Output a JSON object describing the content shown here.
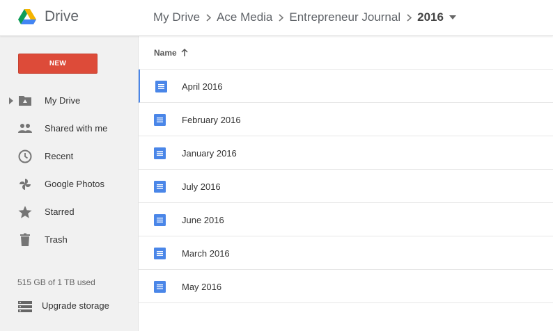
{
  "app": {
    "title": "Drive",
    "logo_icon": "google-drive-logo",
    "logo_colors": [
      "#0f9d58",
      "#f4b400",
      "#4285f4"
    ]
  },
  "breadcrumb": {
    "items": [
      "My Drive",
      "Ace Media",
      "Entrepreneur Journal"
    ],
    "current": "2016",
    "separator_icon": "chevron-right-icon",
    "dropdown_icon": "caret-down-icon"
  },
  "sidebar": {
    "new_button_label": "NEW",
    "new_button_color": "#dd4b39",
    "items": [
      {
        "label": "My Drive",
        "icon": "my-drive-folder-icon"
      },
      {
        "label": "Shared with me",
        "icon": "people-icon"
      },
      {
        "label": "Recent",
        "icon": "clock-icon"
      },
      {
        "label": "Google Photos",
        "icon": "pinwheel-icon"
      },
      {
        "label": "Starred",
        "icon": "star-icon"
      },
      {
        "label": "Trash",
        "icon": "trash-icon"
      }
    ],
    "storage_text": "515 GB of 1 TB used",
    "upgrade_label": "Upgrade storage",
    "upgrade_icon": "storage-icon"
  },
  "list": {
    "column_name": "Name",
    "sort_icon": "arrow-up-icon",
    "file_icon": "google-docs-icon",
    "file_icon_color": "#4a86e8",
    "files": [
      {
        "name": "April 2016"
      },
      {
        "name": "February 2016"
      },
      {
        "name": "January 2016"
      },
      {
        "name": "July 2016"
      },
      {
        "name": "June 2016"
      },
      {
        "name": "March 2016"
      },
      {
        "name": "May 2016"
      }
    ]
  }
}
